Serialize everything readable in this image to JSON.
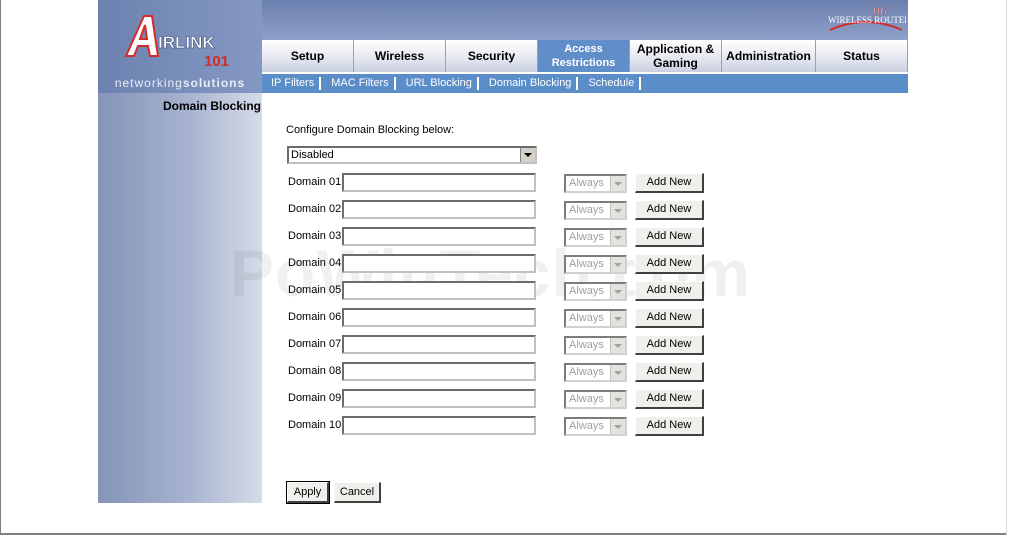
{
  "brand": {
    "logo_text": "AirLink",
    "logo_number": "101",
    "tagline_light": "networking",
    "tagline_bold": "solutions",
    "router_badge": "11G",
    "router_label": "Wireless Router",
    "accent_color": "#5f8ec9"
  },
  "nav": {
    "tabs": [
      {
        "label": "Setup",
        "active": false
      },
      {
        "label": "Wireless",
        "active": false
      },
      {
        "label": "Security",
        "active": false
      },
      {
        "label": "Access Restrictions",
        "active": true
      },
      {
        "label": "Application & Gaming",
        "active": false
      },
      {
        "label": "Administration",
        "active": false
      },
      {
        "label": "Status",
        "active": false
      }
    ],
    "subtabs": [
      "IP Filters",
      "MAC Filters",
      "URL Blocking",
      "Domain Blocking",
      "Schedule"
    ]
  },
  "sidebar": {
    "title": "Domain Blocking"
  },
  "watermark": "PoWinTech.com",
  "form": {
    "configure_label": "Configure Domain Blocking below:",
    "mode_select": "Disabled",
    "domains": [
      {
        "label": "Domain 01:",
        "value": "",
        "schedule": "Always",
        "button": "Add New"
      },
      {
        "label": "Domain 02:",
        "value": "",
        "schedule": "Always",
        "button": "Add New"
      },
      {
        "label": "Domain 03:",
        "value": "",
        "schedule": "Always",
        "button": "Add New"
      },
      {
        "label": "Domain 04:",
        "value": "",
        "schedule": "Always",
        "button": "Add New"
      },
      {
        "label": "Domain 05:",
        "value": "",
        "schedule": "Always",
        "button": "Add New"
      },
      {
        "label": "Domain 06:",
        "value": "",
        "schedule": "Always",
        "button": "Add New"
      },
      {
        "label": "Domain 07:",
        "value": "",
        "schedule": "Always",
        "button": "Add New"
      },
      {
        "label": "Domain 08:",
        "value": "",
        "schedule": "Always",
        "button": "Add New"
      },
      {
        "label": "Domain 09:",
        "value": "",
        "schedule": "Always",
        "button": "Add New"
      },
      {
        "label": "Domain 10:",
        "value": "",
        "schedule": "Always",
        "button": "Add New"
      }
    ],
    "apply_label": "Apply",
    "cancel_label": "Cancel"
  }
}
